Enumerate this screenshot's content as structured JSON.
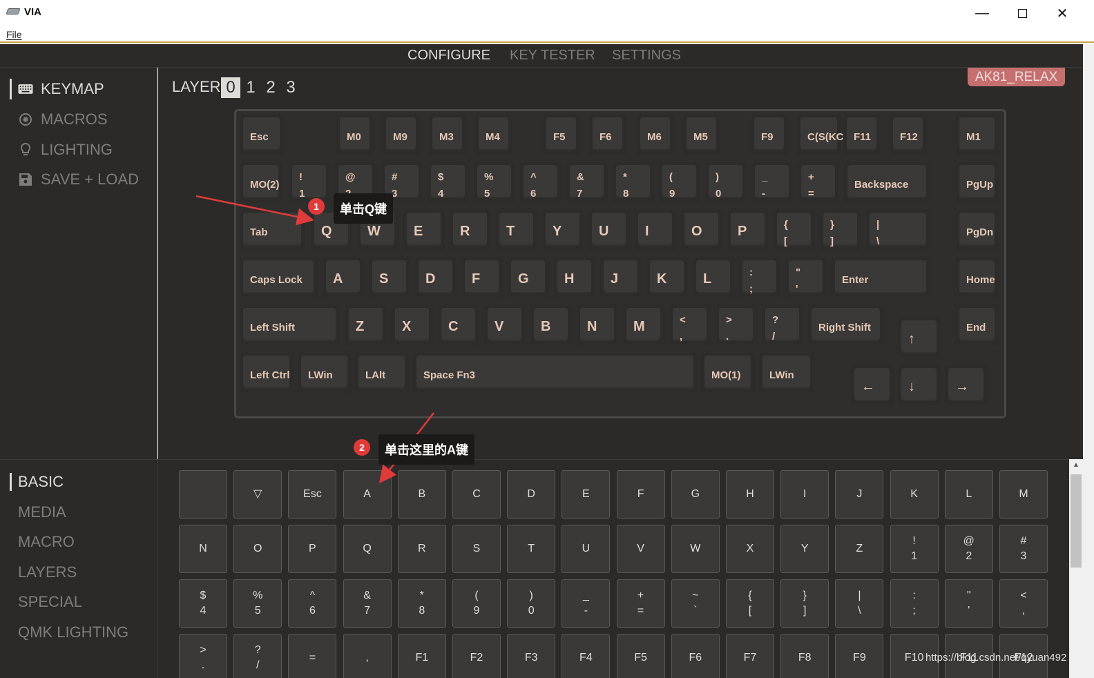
{
  "window": {
    "title": "VIA"
  },
  "menu": {
    "file": "File"
  },
  "topnav": {
    "configure": "CONFIGURE",
    "key_tester": "KEY TESTER",
    "settings": "SETTINGS"
  },
  "sidebar": {
    "keymap": "KEYMAP",
    "macros": "MACROS",
    "lighting": "LIGHTING",
    "save_load": "SAVE + LOAD"
  },
  "layers": {
    "label": "LAYER",
    "items": [
      "0",
      "1",
      "2",
      "3"
    ],
    "active": "0"
  },
  "keyboard": {
    "name": "AK81_RELAX",
    "keys": [
      {
        "t": "Esc"
      },
      {
        "t": "M0"
      },
      {
        "t": "M9"
      },
      {
        "t": "M3"
      },
      {
        "t": "M4"
      },
      {
        "t": "F5"
      },
      {
        "t": "F6"
      },
      {
        "t": "M6"
      },
      {
        "t": "M5"
      },
      {
        "t": "F9"
      },
      {
        "t": "C(S(KC_"
      },
      {
        "t": "F11"
      },
      {
        "t": "F12"
      },
      {
        "t": "M1"
      },
      {
        "t": "MO(2)"
      },
      {
        "t": "!",
        "b": "1"
      },
      {
        "t": "@",
        "b": "2"
      },
      {
        "t": "#",
        "b": "3"
      },
      {
        "t": "$",
        "b": "4"
      },
      {
        "t": "%",
        "b": "5"
      },
      {
        "t": "^",
        "b": "6"
      },
      {
        "t": "&",
        "b": "7"
      },
      {
        "t": "*",
        "b": "8"
      },
      {
        "t": "(",
        "b": "9"
      },
      {
        "t": ")",
        "b": "0"
      },
      {
        "t": "_",
        "b": "-"
      },
      {
        "t": "+",
        "b": "="
      },
      {
        "t": "Backspace"
      },
      {
        "t": "PgUp"
      },
      {
        "t": "Tab"
      },
      {
        "t": "Q"
      },
      {
        "t": "W"
      },
      {
        "t": "E"
      },
      {
        "t": "R"
      },
      {
        "t": "T"
      },
      {
        "t": "Y"
      },
      {
        "t": "U"
      },
      {
        "t": "I"
      },
      {
        "t": "O"
      },
      {
        "t": "P"
      },
      {
        "t": "{",
        "b": "["
      },
      {
        "t": "}",
        "b": "]"
      },
      {
        "t": "|",
        "b": "\\"
      },
      {
        "t": "PgDn"
      },
      {
        "t": "Caps Lock"
      },
      {
        "t": "A"
      },
      {
        "t": "S"
      },
      {
        "t": "D"
      },
      {
        "t": "F"
      },
      {
        "t": "G"
      },
      {
        "t": "H"
      },
      {
        "t": "J"
      },
      {
        "t": "K"
      },
      {
        "t": "L"
      },
      {
        "t": ":",
        "b": ";"
      },
      {
        "t": "\"",
        "b": "'"
      },
      {
        "t": "Enter"
      },
      {
        "t": "Home"
      },
      {
        "t": "Left Shift"
      },
      {
        "t": "Z"
      },
      {
        "t": "X"
      },
      {
        "t": "C"
      },
      {
        "t": "V"
      },
      {
        "t": "B"
      },
      {
        "t": "N"
      },
      {
        "t": "M"
      },
      {
        "t": "<",
        "b": ","
      },
      {
        "t": ">",
        "b": "."
      },
      {
        "t": "?",
        "b": "/"
      },
      {
        "t": "Right Shift"
      },
      {
        "t": "↑"
      },
      {
        "t": "End"
      },
      {
        "t": "Left Ctrl"
      },
      {
        "t": "LWin"
      },
      {
        "t": "LAlt"
      },
      {
        "t": "Space Fn3"
      },
      {
        "t": "MO(1)"
      },
      {
        "t": "LWin"
      },
      {
        "t": "←"
      },
      {
        "t": "↓"
      },
      {
        "t": "→"
      }
    ]
  },
  "bottom": {
    "categories": [
      "BASIC",
      "MEDIA",
      "MACRO",
      "LAYERS",
      "SPECIAL",
      "QMK LIGHTING"
    ],
    "active": "BASIC"
  },
  "basic_keys": [
    [
      ""
    ],
    [
      "▽"
    ],
    [
      "Esc"
    ],
    [
      "A"
    ],
    [
      "B"
    ],
    [
      "C"
    ],
    [
      "D"
    ],
    [
      "E"
    ],
    [
      "F"
    ],
    [
      "G"
    ],
    [
      "H"
    ],
    [
      "I"
    ],
    [
      "J"
    ],
    [
      "K"
    ],
    [
      "L"
    ],
    [
      "M"
    ],
    [
      "N"
    ],
    [
      "O"
    ],
    [
      "P"
    ],
    [
      "Q"
    ],
    [
      "R"
    ],
    [
      "S"
    ],
    [
      "T"
    ],
    [
      "U"
    ],
    [
      "V"
    ],
    [
      "W"
    ],
    [
      "X"
    ],
    [
      "Y"
    ],
    [
      "Z"
    ],
    [
      "!",
      "1"
    ],
    [
      "@",
      "2"
    ],
    [
      "#",
      "3"
    ],
    [
      "$",
      "4"
    ],
    [
      "%",
      "5"
    ],
    [
      "^",
      "6"
    ],
    [
      "&",
      "7"
    ],
    [
      "*",
      "8"
    ],
    [
      "(",
      "9"
    ],
    [
      ")",
      "0"
    ],
    [
      "_",
      "-"
    ],
    [
      "+",
      "="
    ],
    [
      "~",
      "`"
    ],
    [
      "{",
      "["
    ],
    [
      "}",
      "]"
    ],
    [
      "|",
      "\\"
    ],
    [
      ":",
      ";"
    ],
    [
      "\"",
      "'"
    ],
    [
      "<",
      ","
    ],
    [
      ">",
      "."
    ],
    [
      "?",
      "/"
    ],
    [
      "="
    ],
    [
      ","
    ],
    [
      "F1"
    ],
    [
      "F2"
    ],
    [
      "F3"
    ],
    [
      "F4"
    ],
    [
      "F5"
    ],
    [
      "F6"
    ],
    [
      "F7"
    ],
    [
      "F8"
    ],
    [
      "F9"
    ],
    [
      "F10"
    ],
    [
      "F11"
    ],
    [
      "F12"
    ]
  ],
  "annotations": {
    "step1": "单击Q键",
    "step2": "单击这里的A键",
    "badge1": "1",
    "badge2": "2"
  },
  "watermark": "https://blog.csdn.net/qyuan492",
  "colors": {
    "bg": "#2b2a29",
    "keycap": "#3a3938",
    "legend": "#e6c8b8",
    "accent": "#c56f6f",
    "annotation": "#e03b3b"
  }
}
